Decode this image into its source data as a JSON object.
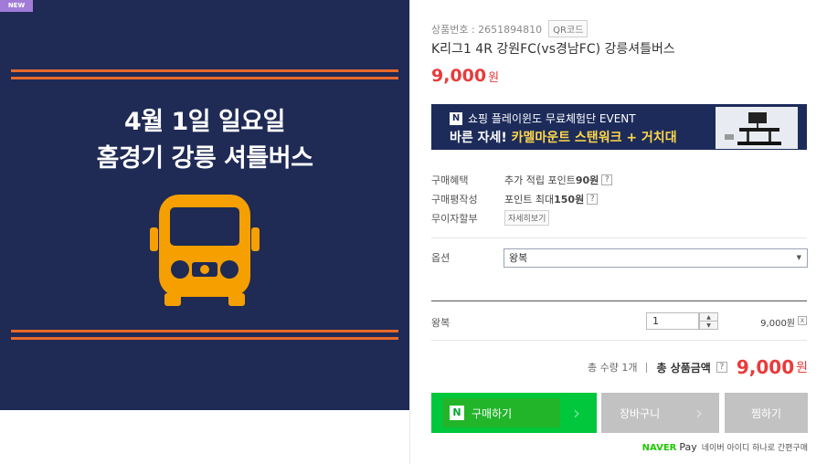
{
  "hero": {
    "badge": "NEW",
    "title_line1": "4월 1일 일요일",
    "title_line2": "홈경기 강릉 셔틀버스",
    "bg_color": "#1f2a55",
    "stripe_color": "#e6692b",
    "bus_color": "#f5a000",
    "icon": "bus-icon"
  },
  "product": {
    "number_label": "상품번호 : 2651894810",
    "qr_label": "QR코드",
    "title": "K리그1 4R 강원FC(vs경남FC) 강릉셔틀버스",
    "price": "9,000",
    "price_unit": "원"
  },
  "banner": {
    "line1_badge": "N",
    "line1": "쇼핑 플레이윈도 무료체험단 EVENT",
    "line2_a": "바른 자세! ",
    "line2_b": "카멜마운트 스탠워크 + 거치대"
  },
  "benefits": [
    {
      "label": "구매혜택",
      "pre": "추가 적립 포인트 ",
      "bold": "90원",
      "help": "?"
    },
    {
      "label": "구매평작성",
      "pre": "포인트 최대 ",
      "bold": "150원",
      "help": "?"
    },
    {
      "label": "무이자할부",
      "button": "자세히보기"
    }
  ],
  "option": {
    "label": "옵션",
    "selected": "왕복"
  },
  "selected_item": {
    "name": "왕복",
    "quantity": "1",
    "price": "9,000원",
    "remove": "x"
  },
  "total": {
    "qty": "총 수량 1개",
    "label": "총 상품금액",
    "help": "?",
    "amount": "9,000",
    "unit": "원"
  },
  "buttons": {
    "buy_badge": "N",
    "buy": "구매하기",
    "cart": "장바구니",
    "wish": "찜하기"
  },
  "npay": {
    "logo": "NAVER",
    "pay": "Pay",
    "text": "네이버 아이디 하나로 간편구매"
  },
  "colors": {
    "accent_red": "#e93b3b",
    "naver_green": "#00c73c",
    "gray_button": "#c2c2c2"
  }
}
